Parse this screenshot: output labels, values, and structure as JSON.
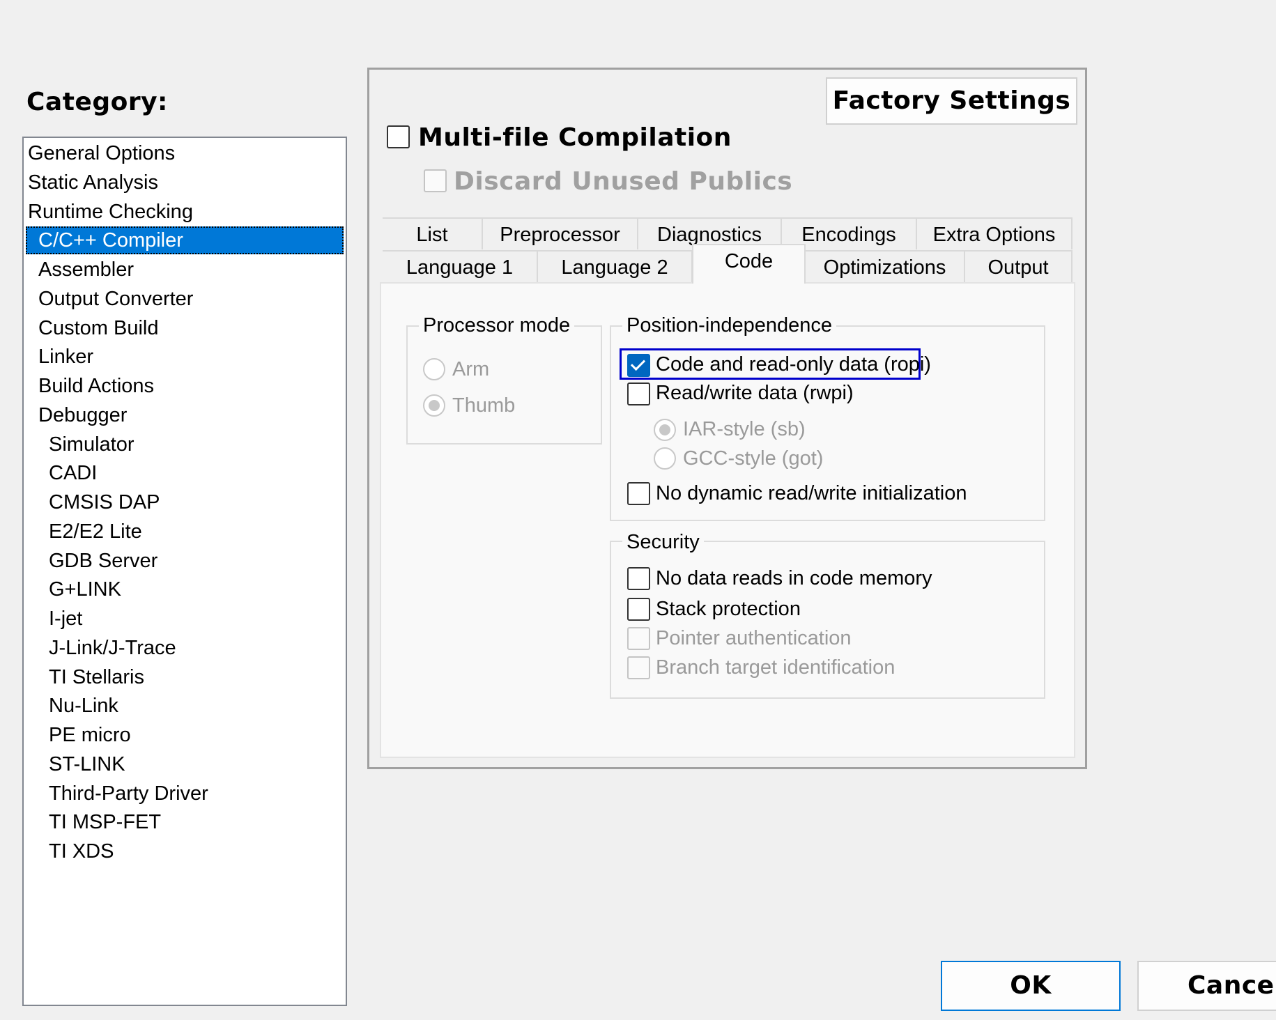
{
  "category": {
    "label": "Category:",
    "items": [
      {
        "label": "General Options",
        "level": 0
      },
      {
        "label": "Static Analysis",
        "level": 0
      },
      {
        "label": "Runtime Checking",
        "level": 0
      },
      {
        "label": "C/C++ Compiler",
        "level": 1,
        "selected": true
      },
      {
        "label": "Assembler",
        "level": 1
      },
      {
        "label": "Output Converter",
        "level": 1
      },
      {
        "label": "Custom Build",
        "level": 1
      },
      {
        "label": "Linker",
        "level": 1
      },
      {
        "label": "Build Actions",
        "level": 1
      },
      {
        "label": "Debugger",
        "level": 1
      },
      {
        "label": "Simulator",
        "level": 2
      },
      {
        "label": "CADI",
        "level": 2
      },
      {
        "label": "CMSIS DAP",
        "level": 2
      },
      {
        "label": "E2/E2 Lite",
        "level": 2
      },
      {
        "label": "GDB Server",
        "level": 2
      },
      {
        "label": "G+LINK",
        "level": 2
      },
      {
        "label": "I-jet",
        "level": 2
      },
      {
        "label": "J-Link/J-Trace",
        "level": 2
      },
      {
        "label": "TI Stellaris",
        "level": 2
      },
      {
        "label": "Nu-Link",
        "level": 2
      },
      {
        "label": "PE micro",
        "level": 2
      },
      {
        "label": "ST-LINK",
        "level": 2
      },
      {
        "label": "Third-Party Driver",
        "level": 2
      },
      {
        "label": "TI MSP-FET",
        "level": 2
      },
      {
        "label": "TI XDS",
        "level": 2
      }
    ]
  },
  "panel": {
    "factory_settings": "Factory Settings",
    "multi_file_compilation": "Multi-file Compilation",
    "discard_unused_publics": "Discard Unused Publics"
  },
  "tabs": {
    "row1": [
      "List",
      "Preprocessor",
      "Diagnostics",
      "Encodings",
      "Extra Options"
    ],
    "row2": [
      "Language 1",
      "Language 2",
      "Code",
      "Optimizations",
      "Output"
    ],
    "active": "Code"
  },
  "processor_mode": {
    "title": "Processor mode",
    "arm": "Arm",
    "thumb": "Thumb",
    "selected": "Thumb"
  },
  "position_independence": {
    "title": "Position-independence",
    "ropi": "Code and read-only data (ropi)",
    "rwpi": "Read/write data (rwpi)",
    "iar_style": "IAR-style (sb)",
    "gcc_style": "GCC-style (got)",
    "no_dynamic": "No dynamic read/write initialization",
    "ropi_checked": true,
    "rwpi_checked": false,
    "no_dynamic_checked": false
  },
  "security": {
    "title": "Security",
    "no_data_reads": "No data reads in code memory",
    "stack_protection": "Stack protection",
    "pointer_auth": "Pointer authentication",
    "branch_target": "Branch target identification"
  },
  "buttons": {
    "ok": "OK",
    "cancel": "Cancel"
  },
  "colors": {
    "selection": "#0078d7",
    "checkbox_checked": "#0067c0",
    "focus_border": "#0000cc"
  }
}
